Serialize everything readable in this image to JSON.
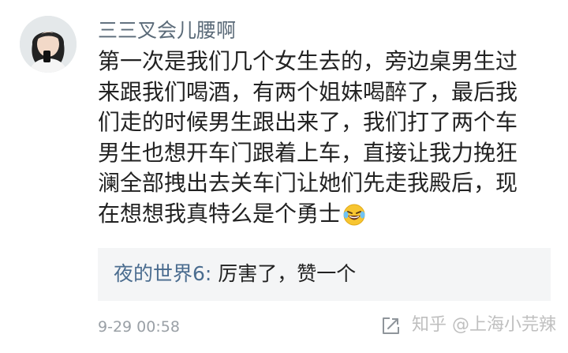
{
  "comment": {
    "username": "三三叉会儿腰啊",
    "lines": [
      "第一次是我们几个女生去的，旁边桌男生过",
      "来跟我们喝酒，有两个姐妹喝醉了，最后我",
      "们走的时候男生跟出来了，我们打了两个车",
      "男生也想开车门跟着上车，直接让我力挽狂",
      "澜全部拽出去关车门让她们先走我殿后，现",
      "在想想我真特么是个勇士"
    ],
    "emoji": "laughing-crying-emoji",
    "timestamp": "9-29 00:58"
  },
  "reply": {
    "author": "夜的世界6:",
    "text": " 厉害了，赞一个"
  },
  "watermark": "知乎 @上海小芫辣",
  "colors": {
    "username": "#5a6a78",
    "reply_author": "#4a6c8f",
    "reply_background": "#f4f5f6",
    "text": "#222222",
    "timestamp": "#9aa0a6"
  }
}
